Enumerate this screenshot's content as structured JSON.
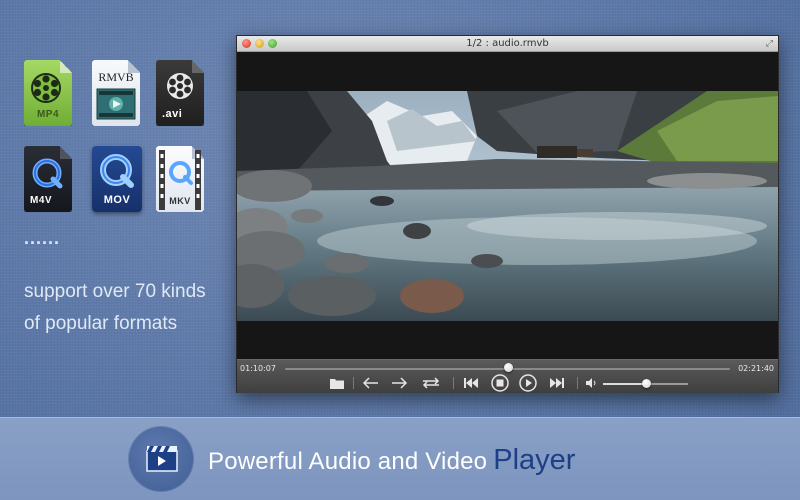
{
  "formats": [
    {
      "ext": "MP4",
      "icon": "film-reel-icon",
      "color": "#8fc84a"
    },
    {
      "ext": "RMVB",
      "icon": "rmvb-file-icon",
      "color": "#e9eef5"
    },
    {
      "ext": ".avi",
      "icon": "film-reel-icon",
      "color": "#2b2b2b"
    },
    {
      "ext": "M4V",
      "icon": "quicktime-icon",
      "color": "#1d1f26"
    },
    {
      "ext": "MOV",
      "icon": "quicktime-icon",
      "color": "#1c3f86"
    },
    {
      "ext": "MKV",
      "icon": "quicktime-icon",
      "color": "#eef2f7"
    }
  ],
  "dots": "......",
  "support_text": "support over 70 kinds of popular formats",
  "player": {
    "title": "1/2 : audio.rmvb",
    "time_current": "01:10:07",
    "time_total": "02:21:40",
    "seek_progress": 0.5,
    "volume_level": 0.5
  },
  "banner": {
    "tagline_main": "Powerful Audio and Video",
    "tagline_accent": "Player",
    "accent_color": "#1c3f86"
  }
}
